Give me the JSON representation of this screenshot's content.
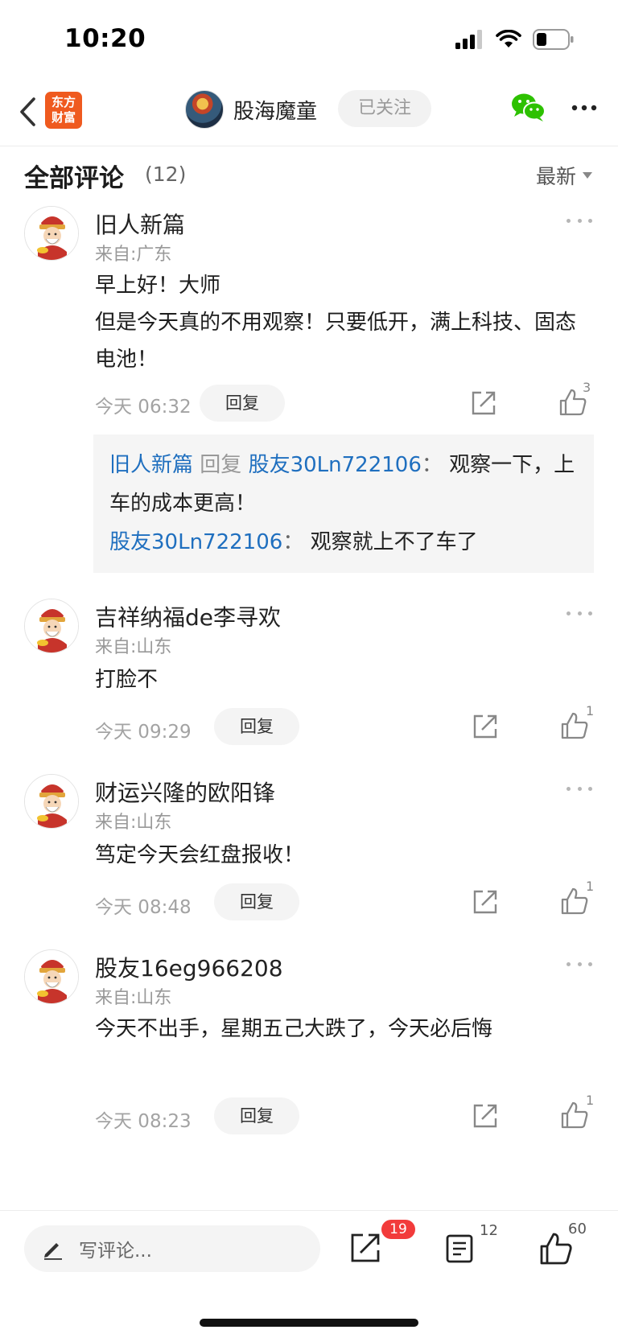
{
  "status_bar": {
    "time": "10:20"
  },
  "nav": {
    "logo_line1": "东方",
    "logo_line2": "财富",
    "author_name": "股海魔童",
    "follow_label": "已关注",
    "wechat_icon": "wechat-icon",
    "more_icon": "more-horizontal-icon"
  },
  "section": {
    "title": "全部评论",
    "count": "(12)",
    "sort_label": "最新"
  },
  "comments": [
    {
      "name": "旧人新篇",
      "location": "来自:广东",
      "text": [
        "早上好！大师",
        "但是今天真的不用观察！只要低开，满上科技、固态电池！"
      ],
      "time": "今天 06:32",
      "reply_label": "回复",
      "likes": "3",
      "replies": [
        {
          "from": "旧人新篇",
          "verb": "回复",
          "to": "股友30Ln722106",
          "colon": "：",
          "text": "观察一下，上车的成本更高！"
        },
        {
          "from": "股友30Ln722106",
          "colon": "：",
          "text": "观察就上不了车了"
        }
      ]
    },
    {
      "name": "吉祥纳福de李寻欢",
      "location": "来自:山东",
      "text": [
        "打脸不"
      ],
      "time": "今天 09:29",
      "reply_label": "回复",
      "likes": "1"
    },
    {
      "name": "财运兴隆的欧阳锋",
      "location": "来自:山东",
      "text": [
        "笃定今天会红盘报收！"
      ],
      "time": "今天 08:48",
      "reply_label": "回复",
      "likes": "1"
    },
    {
      "name": "股友16eg966208",
      "location": "来自:山东",
      "text": [
        "今天不出手，星期五己大跌了，今天必后悔"
      ],
      "time": "今天 08:23",
      "reply_label": "回复",
      "likes": "1"
    }
  ],
  "bottom_bar": {
    "input_placeholder": "写评论...",
    "share_badge": "19",
    "list_count": "12",
    "like_count": "60"
  },
  "colors": {
    "brand_orange": "#ef5a1f",
    "link_blue": "#1f6fbf",
    "badge_red": "#f23b3b",
    "wechat_green": "#2dc100"
  }
}
